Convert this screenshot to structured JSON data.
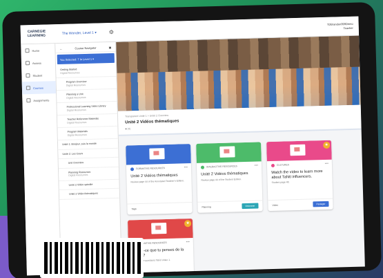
{
  "app": {
    "logo_line1": "CARNEGIE",
    "logo_line2": "LEARNING",
    "course": "The Wonder, Level 1 ▾",
    "user_name": "TDBrandon999Demo",
    "user_role": "Teacher"
  },
  "nav": {
    "items": [
      {
        "label": "Home",
        "icon": "home-icon"
      },
      {
        "label": "Assess",
        "icon": "assess-icon"
      },
      {
        "label": "Student",
        "icon": "student-icon"
      },
      {
        "label": "Courses",
        "icon": "courses-icon"
      },
      {
        "label": "Assignments",
        "icon": "assignments-icon"
      }
    ]
  },
  "navigator": {
    "header": "Course Navigator",
    "back": "←",
    "unit": "You Selected: T le Level 1 ▾",
    "items": [
      {
        "title": "Getting Started",
        "sub": "Digital Resources",
        "level": 1
      },
      {
        "title": "Program Overview",
        "sub": "Digital Resources",
        "level": 2
      },
      {
        "title": "Planning a Unit",
        "sub": "Digital Resources",
        "level": 2
      },
      {
        "title": "Professional Learning Video Library",
        "sub": "Digital Resources",
        "level": 2
      },
      {
        "title": "Teacher Reference Materials",
        "sub": "Digital Resources",
        "level": 2
      },
      {
        "title": "Program Materials",
        "sub": "Digital Resources",
        "level": 2
      },
      {
        "title": "Unité 1: Bonjour, suis la monde",
        "sub": "",
        "level": 1
      },
      {
        "title": "Unité 2: Les Cours",
        "sub": "",
        "level": 1
      },
      {
        "title": "Unit Overview",
        "sub": "",
        "level": 2
      },
      {
        "title": "Planning Resources",
        "sub": "Digital Resources",
        "level": 2
      },
      {
        "title": "Unité 2 Vidéo spécifié",
        "sub": "",
        "level": 2
      },
      {
        "title": "Unité 2 Vidéo thématiques",
        "sub": "",
        "level": 2
      }
    ]
  },
  "main": {
    "breadcrumb": "Transparent Unité 1   >   Unité 2 Overview",
    "title": "Unité 2 Vidéos thématiques",
    "subtitle": "■ (4)",
    "cards": [
      {
        "type": "FORMATIVE RESOURCES",
        "title": "Unité 2 Vidéos thématiques",
        "desc": "Review page 44 of the Annotated Teacher's Edition.",
        "foot": "Tags",
        "button": "",
        "color": "#3c6fd4",
        "star": false
      },
      {
        "type": "INTERACTIVE RESOURCES",
        "title": "Unité 2 Vidéos thématiques",
        "desc": "Review page 44 of the Student Edition.",
        "foot": "Planning",
        "button": "Visionner",
        "color": "#4dbb6a",
        "star": false
      },
      {
        "type": "CULTURES",
        "title": "Watch the video to learn more about Tahiti influencers.",
        "desc": "Student page 48.",
        "foot": "Video",
        "button": "Partager",
        "color": "#e94a8a",
        "star": true
      },
      {
        "type": "FORMATIVE RESOURCES",
        "title": "Qu'est-ce que tu penses de la vidéo ?",
        "desc": "Answer the questions Tahiti Video 1.",
        "foot": "",
        "button": "",
        "color": "#e04848",
        "star": true
      }
    ],
    "star_glyph": "★",
    "menu_glyph": "•••"
  },
  "colors": {
    "accent": "#3c6fd4",
    "green": "#4dbb6a",
    "pink": "#e94a8a",
    "red": "#e04848",
    "star": "#f1b22d"
  }
}
